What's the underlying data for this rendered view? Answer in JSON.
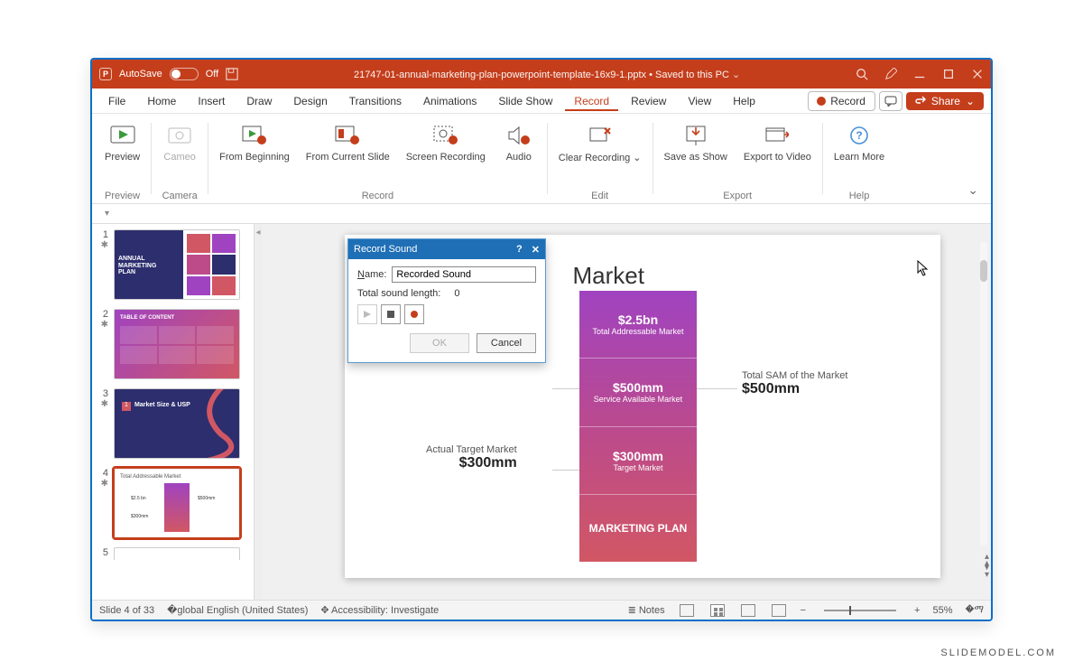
{
  "titlebar": {
    "autosave_label": "AutoSave",
    "autosave_state": "Off",
    "filename": "21747-01-annual-marketing-plan-powerpoint-template-16x9-1.pptx",
    "save_state": "Saved to this PC"
  },
  "menu": {
    "items": [
      "File",
      "Home",
      "Insert",
      "Draw",
      "Design",
      "Transitions",
      "Animations",
      "Slide Show",
      "Record",
      "Review",
      "View",
      "Help"
    ],
    "active": "Record",
    "record_btn": "Record",
    "share_btn": "Share"
  },
  "ribbon": {
    "groups": [
      {
        "label": "Preview",
        "buttons": [
          {
            "label": "Preview",
            "disabled": false
          }
        ]
      },
      {
        "label": "Camera",
        "buttons": [
          {
            "label": "Cameo",
            "disabled": true
          }
        ]
      },
      {
        "label": "Record",
        "buttons": [
          {
            "label": "From Beginning"
          },
          {
            "label": "From Current Slide"
          },
          {
            "label": "Screen Recording"
          },
          {
            "label": "Audio"
          }
        ]
      },
      {
        "label": "Edit",
        "buttons": [
          {
            "label": "Clear Recording ⌄"
          }
        ]
      },
      {
        "label": "Export",
        "buttons": [
          {
            "label": "Save as Show"
          },
          {
            "label": "Export to Video"
          }
        ]
      },
      {
        "label": "Help",
        "buttons": [
          {
            "label": "Learn More"
          }
        ]
      }
    ]
  },
  "dialog": {
    "title": "Record Sound",
    "name_label": "Name:",
    "name_value": "Recorded Sound",
    "length_label": "Total sound length:",
    "length_value": "0",
    "ok": "OK",
    "cancel": "Cancel"
  },
  "slide": {
    "title_visible_tail": "Market",
    "funnel": [
      {
        "big": "$2.5bn",
        "small": "Total Addressable Market"
      },
      {
        "big": "$500mm",
        "small": "Service Available Market"
      },
      {
        "big": "$300mm",
        "small": "Target Market"
      },
      {
        "big": "MARKETING PLAN",
        "small": ""
      }
    ],
    "left_callout": {
      "label": "Actual Target Market",
      "value": "$300mm"
    },
    "right_callout": {
      "label": "Total SAM of the Market",
      "value": "$500mm"
    }
  },
  "thumbs": [
    {
      "n": 1,
      "star": true,
      "title": "ANNUAL MARKETING PLAN",
      "bg": "navy"
    },
    {
      "n": 2,
      "star": true,
      "title": "TABLE OF CONTENT",
      "bg": "grad"
    },
    {
      "n": 3,
      "star": true,
      "title": "Market Size & USP",
      "bg": "navy"
    },
    {
      "n": 4,
      "star": true,
      "title": "Total Addressable Market",
      "bg": "white",
      "selected": true
    },
    {
      "n": 5,
      "star": false,
      "title": "",
      "bg": "white"
    }
  ],
  "status": {
    "slide": "Slide 4 of 33",
    "lang": "English (United States)",
    "access": "Accessibility: Investigate",
    "notes": "Notes",
    "zoom": "55%"
  },
  "watermark": "SLIDEMODEL.COM"
}
